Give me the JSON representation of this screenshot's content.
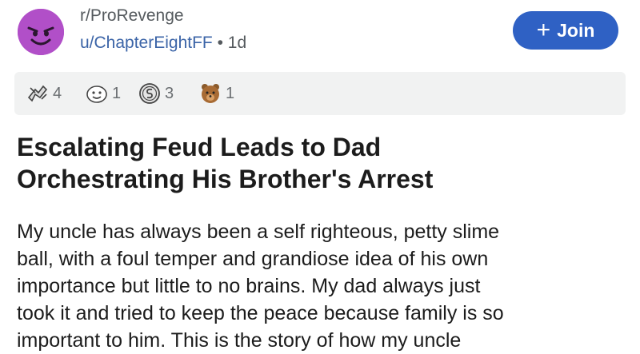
{
  "subreddit": "r/ProRevenge",
  "author": "u/ChapterEightFF",
  "separator": "•",
  "age": "1d",
  "join_label": "Join",
  "join_plus": "+",
  "accent_color": "#2f61c4",
  "avatar_color": "#b14fc8",
  "awards": [
    {
      "icon": "helping-hand-award-icon",
      "count": "4"
    },
    {
      "icon": "wholesome-award-icon",
      "count": "1"
    },
    {
      "icon": "silver-coin-award-icon",
      "count": "3"
    },
    {
      "icon": "bear-award-icon",
      "count": "1"
    }
  ],
  "post": {
    "title_lines": [
      "Escalating Feud Leads to Dad",
      "Orchestrating His Brother's Arrest"
    ],
    "body_lines": [
      "My uncle has always been a self righteous, petty slime",
      "ball, with a foul temper and grandiose idea of his own",
      "importance but little to no brains. My dad always just",
      "took it and tried to keep the peace because family is so",
      "important to him. This is the story of how my uncle"
    ]
  }
}
